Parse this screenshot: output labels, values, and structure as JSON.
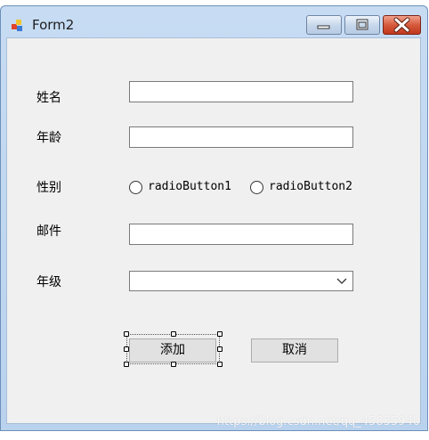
{
  "window": {
    "title": "Form2",
    "accent_color": "#c7dcf3",
    "close_color": "#d55a3d",
    "icons": [
      "app-form-icon",
      "minimize-icon",
      "maximize-icon",
      "close-icon"
    ]
  },
  "form": {
    "name_label": "姓名",
    "age_label": "年龄",
    "gender_label": "性别",
    "email_label": "邮件",
    "grade_label": "年级",
    "name_value": "",
    "age_value": "",
    "email_value": "",
    "grade_selected": "",
    "radio1_label": "radioButton1",
    "radio2_label": "radioButton2",
    "add_button": "添加",
    "cancel_button": "取消"
  },
  "watermark": "https://blog.csdn.net/qq_45835940"
}
